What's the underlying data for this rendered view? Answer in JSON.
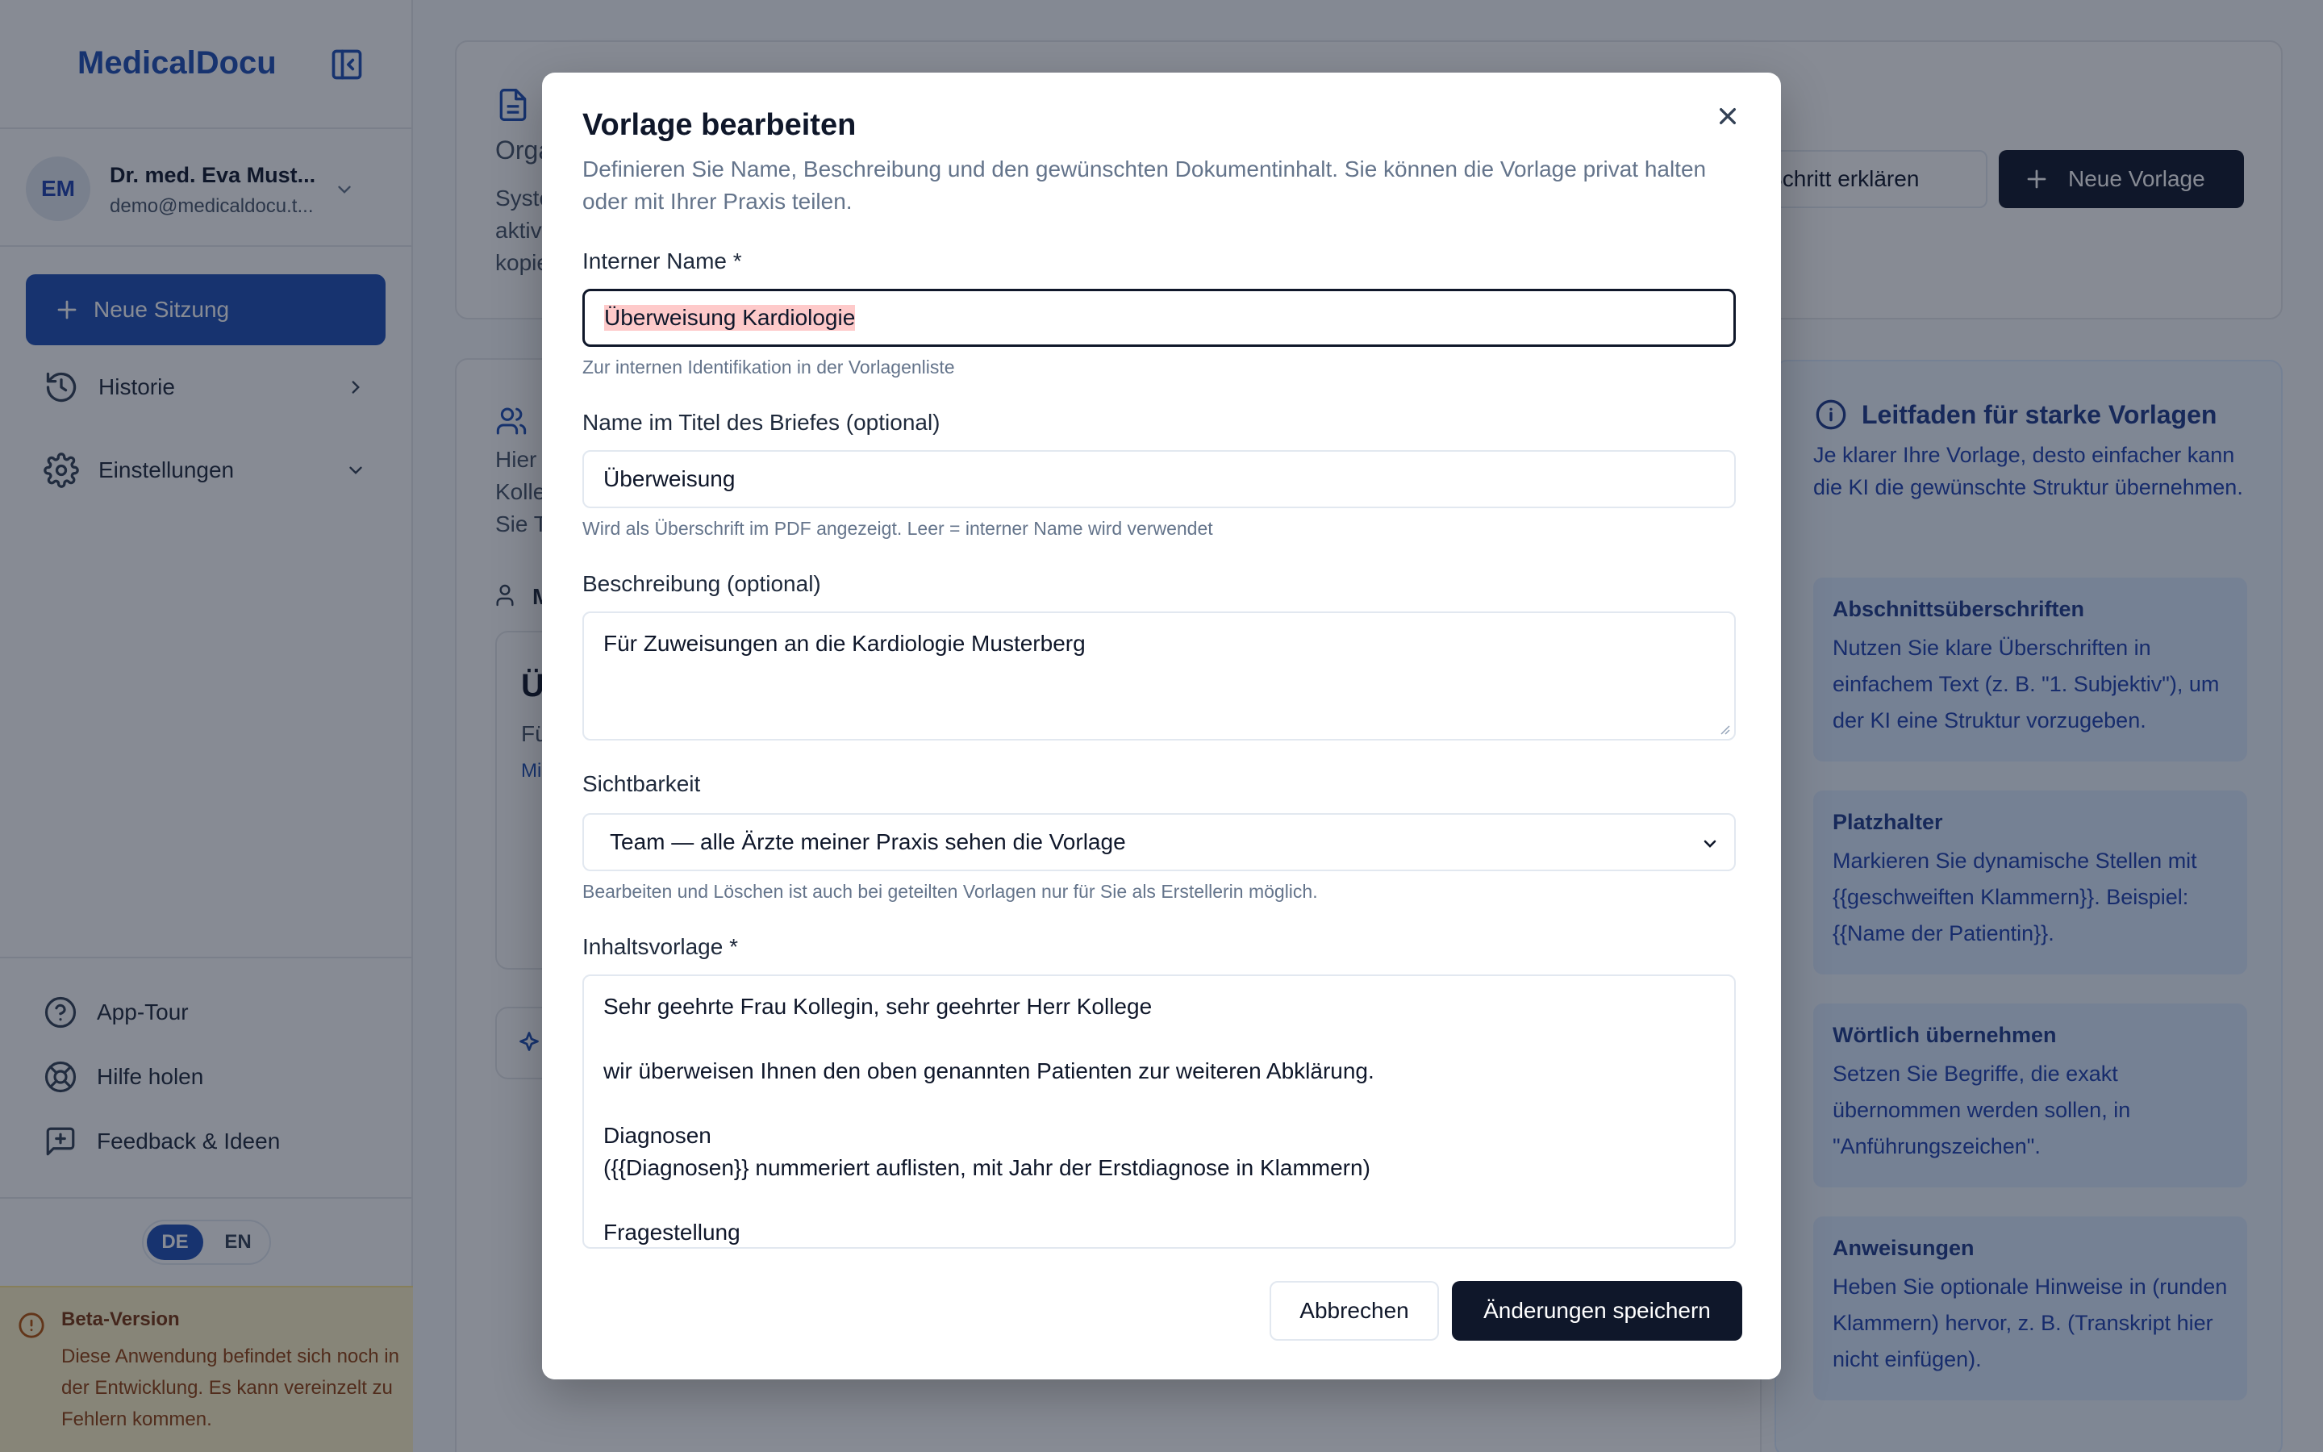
{
  "app": {
    "brand": "MedicalDocu"
  },
  "user": {
    "initials": "EM",
    "name": "Dr. med. Eva Must...",
    "email": "demo@medicaldocu.t..."
  },
  "sidebar": {
    "new_session": "Neue Sitzung",
    "items": [
      {
        "label": "Historie"
      },
      {
        "label": "Einstellungen"
      }
    ],
    "footer_items": [
      {
        "label": "App-Tour"
      },
      {
        "label": "Hilfe holen"
      },
      {
        "label": "Feedback & Ideen"
      }
    ],
    "languages": [
      "DE",
      "EN"
    ],
    "active_language": "DE",
    "beta": {
      "title": "Beta-Version",
      "text": "Diese Anwendung befindet sich noch in der Entwicklung. Es kann vereinzelt zu Fehlern kommen."
    }
  },
  "background": {
    "header_fragment_1": "Orga",
    "header_fragment_2": "Syste",
    "header_fragment_3": "aktiv",
    "header_fragment_4": "kopie",
    "explain_button": "r Schritt erklären",
    "new_template_button": "Neue Vorlage",
    "team_fragment_1": "Hier",
    "team_fragment_2": "Kolle",
    "team_fragment_3": "Sie T",
    "list_fragment_1": "M",
    "card_fragment_1": "Ü",
    "card_fragment_2": "Fü",
    "card_fragment_3": "Mi"
  },
  "guide": {
    "title": "Leitfaden für starke Vorlagen",
    "intro": "Je klarer Ihre Vorlage, desto einfacher kann die KI die gewünschte Struktur übernehmen.",
    "tips": [
      {
        "title": "Abschnittsüberschriften",
        "text": "Nutzen Sie klare Überschriften in einfachem Text (z. B. \"1. Subjektiv\"), um der KI eine Struktur vorzugeben."
      },
      {
        "title": "Platzhalter",
        "text": "Markieren Sie dynamische Stellen mit {{geschweiften Klammern}}. Beispiel: {{Name der Patientin}}."
      },
      {
        "title": "Wörtlich übernehmen",
        "text": "Setzen Sie Begriffe, die exakt übernommen werden sollen, in \"Anführungszeichen\"."
      },
      {
        "title": "Anweisungen",
        "text": "Heben Sie optionale Hinweise in (runden Klammern) hervor, z. B. (Transkript hier nicht einfügen)."
      }
    ]
  },
  "modal": {
    "title": "Vorlage bearbeiten",
    "description": "Definieren Sie Name, Beschreibung und den gewünschten Dokumentinhalt. Sie können die Vorlage privat halten oder mit Ihrer Praxis teilen.",
    "internal_name": {
      "label": "Interner Name *",
      "value": "Überweisung Kardiologie",
      "hint": "Zur internen Identifikation in der Vorlagenliste"
    },
    "letter_title": {
      "label": "Name im Titel des Briefes (optional)",
      "value": "Überweisung",
      "hint": "Wird als Überschrift im PDF angezeigt. Leer = interner Name wird verwendet"
    },
    "description_field": {
      "label": "Beschreibung (optional)",
      "value": "Für Zuweisungen an die Kardiologie Musterberg"
    },
    "visibility": {
      "label": "Sichtbarkeit",
      "selected": "Team — alle Ärzte meiner Praxis sehen die Vorlage",
      "hint": "Bearbeiten und Löschen ist auch bei geteilten Vorlagen nur für Sie als Erstellerin möglich."
    },
    "content": {
      "label": "Inhaltsvorlage *",
      "lines": [
        "Sehr geehrte Frau Kollegin, sehr geehrter Herr Kollege",
        "",
        "wir überweisen Ihnen den oben genannten Patienten zur weiteren Abklärung.",
        "",
        "Diagnosen",
        "({{Diagnosen}} nummeriert auflisten, mit Jahr der Erstdiagnose in Klammern)",
        "",
        "Fragestellung"
      ]
    },
    "cancel": "Abbrechen",
    "save": "Änderungen speichern"
  }
}
